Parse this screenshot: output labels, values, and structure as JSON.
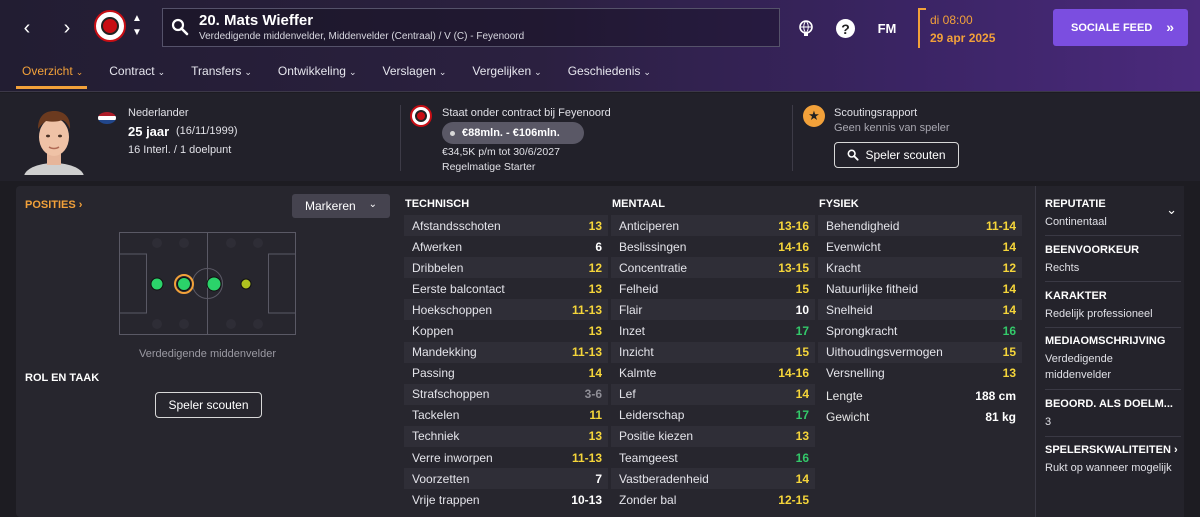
{
  "header": {
    "player_title": "20. Mats Wieffer",
    "player_subtitle": "Verdedigende middenvelder, Middenvelder (Centraal) / V (C) - Feyenoord",
    "fm_label": "FM",
    "date_day": "di 08:00",
    "date_full": "29 apr 2025",
    "social_label": "SOCIALE FEED",
    "accent": "#f2a13a",
    "social_color": "#7b4ee0"
  },
  "tabs": [
    {
      "label": "Overzicht"
    },
    {
      "label": "Contract"
    },
    {
      "label": "Transfers"
    },
    {
      "label": "Ontwikkeling"
    },
    {
      "label": "Verslagen"
    },
    {
      "label": "Vergelijken"
    },
    {
      "label": "Geschiedenis"
    }
  ],
  "info": {
    "nationality": "Nederlander",
    "age": "25 jaar",
    "birthdate": "(16/11/1999)",
    "caps": "16 Interl. / 1 doelpunt",
    "contract_title": "Staat onder contract bij Feyenoord",
    "value_range": "€88mln. - €106mln.",
    "wage": "€34,5K p/m tot 30/6/2027",
    "squad_status": "Regelmatige Starter",
    "scout_title": "Scoutingsrapport",
    "scout_sub": "Geen kennis van speler",
    "scout_button": "Speler scouten"
  },
  "positions": {
    "label": "POSITIES",
    "mark_button": "Markeren",
    "caption": "Verdedigende middenvelder",
    "role_label": "ROL EN TAAK",
    "scout_button": "Speler scouten"
  },
  "attributes": {
    "technical_header": "TECHNISCH",
    "mental_header": "MENTAAL",
    "physical_header": "FYSIEK",
    "technical": [
      {
        "name": "Afstandsschoten",
        "value": "13",
        "tone": "yellow"
      },
      {
        "name": "Afwerken",
        "value": "6",
        "tone": "white"
      },
      {
        "name": "Dribbelen",
        "value": "12",
        "tone": "yellow"
      },
      {
        "name": "Eerste balcontact",
        "value": "13",
        "tone": "yellow"
      },
      {
        "name": "Hoekschoppen",
        "value": "11-13",
        "tone": "yellow"
      },
      {
        "name": "Koppen",
        "value": "13",
        "tone": "yellow"
      },
      {
        "name": "Mandekking",
        "value": "11-13",
        "tone": "yellow"
      },
      {
        "name": "Passing",
        "value": "14",
        "tone": "yellow"
      },
      {
        "name": "Strafschoppen",
        "value": "3-6",
        "tone": "grey"
      },
      {
        "name": "Tackelen",
        "value": "11",
        "tone": "yellow"
      },
      {
        "name": "Techniek",
        "value": "13",
        "tone": "yellow"
      },
      {
        "name": "Verre inworpen",
        "value": "11-13",
        "tone": "yellow"
      },
      {
        "name": "Voorzetten",
        "value": "7",
        "tone": "white"
      },
      {
        "name": "Vrije trappen",
        "value": "10-13",
        "tone": "white"
      }
    ],
    "mental": [
      {
        "name": "Anticiperen",
        "value": "13-16",
        "tone": "yellow"
      },
      {
        "name": "Beslissingen",
        "value": "14-16",
        "tone": "yellow"
      },
      {
        "name": "Concentratie",
        "value": "13-15",
        "tone": "yellow"
      },
      {
        "name": "Felheid",
        "value": "15",
        "tone": "yellow"
      },
      {
        "name": "Flair",
        "value": "10",
        "tone": "white"
      },
      {
        "name": "Inzet",
        "value": "17",
        "tone": "green"
      },
      {
        "name": "Inzicht",
        "value": "15",
        "tone": "yellow"
      },
      {
        "name": "Kalmte",
        "value": "14-16",
        "tone": "yellow"
      },
      {
        "name": "Lef",
        "value": "14",
        "tone": "yellow"
      },
      {
        "name": "Leiderschap",
        "value": "17",
        "tone": "green"
      },
      {
        "name": "Positie kiezen",
        "value": "13",
        "tone": "yellow"
      },
      {
        "name": "Teamgeest",
        "value": "16",
        "tone": "green"
      },
      {
        "name": "Vastberadenheid",
        "value": "14",
        "tone": "yellow"
      },
      {
        "name": "Zonder bal",
        "value": "12-15",
        "tone": "yellow"
      }
    ],
    "physical": [
      {
        "name": "Behendigheid",
        "value": "11-14",
        "tone": "yellow"
      },
      {
        "name": "Evenwicht",
        "value": "14",
        "tone": "yellow"
      },
      {
        "name": "Kracht",
        "value": "12",
        "tone": "yellow"
      },
      {
        "name": "Natuurlijke fitheid",
        "value": "14",
        "tone": "yellow"
      },
      {
        "name": "Snelheid",
        "value": "14",
        "tone": "yellow"
      },
      {
        "name": "Sprongkracht",
        "value": "16",
        "tone": "green"
      },
      {
        "name": "Uithoudingsvermogen",
        "value": "15",
        "tone": "yellow"
      },
      {
        "name": "Versnelling",
        "value": "13",
        "tone": "yellow"
      }
    ],
    "height_label": "Lengte",
    "height_value": "188 cm",
    "weight_label": "Gewicht",
    "weight_value": "81 kg"
  },
  "side": {
    "reputation_h": "REPUTATIE",
    "reputation_v": "Continentaal",
    "foot_h": "BEENVOORKEUR",
    "foot_v": "Rechts",
    "character_h": "KARAKTER",
    "character_v": "Redelijk professioneel",
    "media_h": "MEDIAOMSCHRIJVING",
    "media_v": "Verdedigende middenvelder",
    "gk_h": "BEOORD. ALS DOELM...",
    "gk_v": "3",
    "qual_h": "SPELERSKWALITEITEN",
    "qual_v": "Rukt op wanneer mogelijk"
  }
}
